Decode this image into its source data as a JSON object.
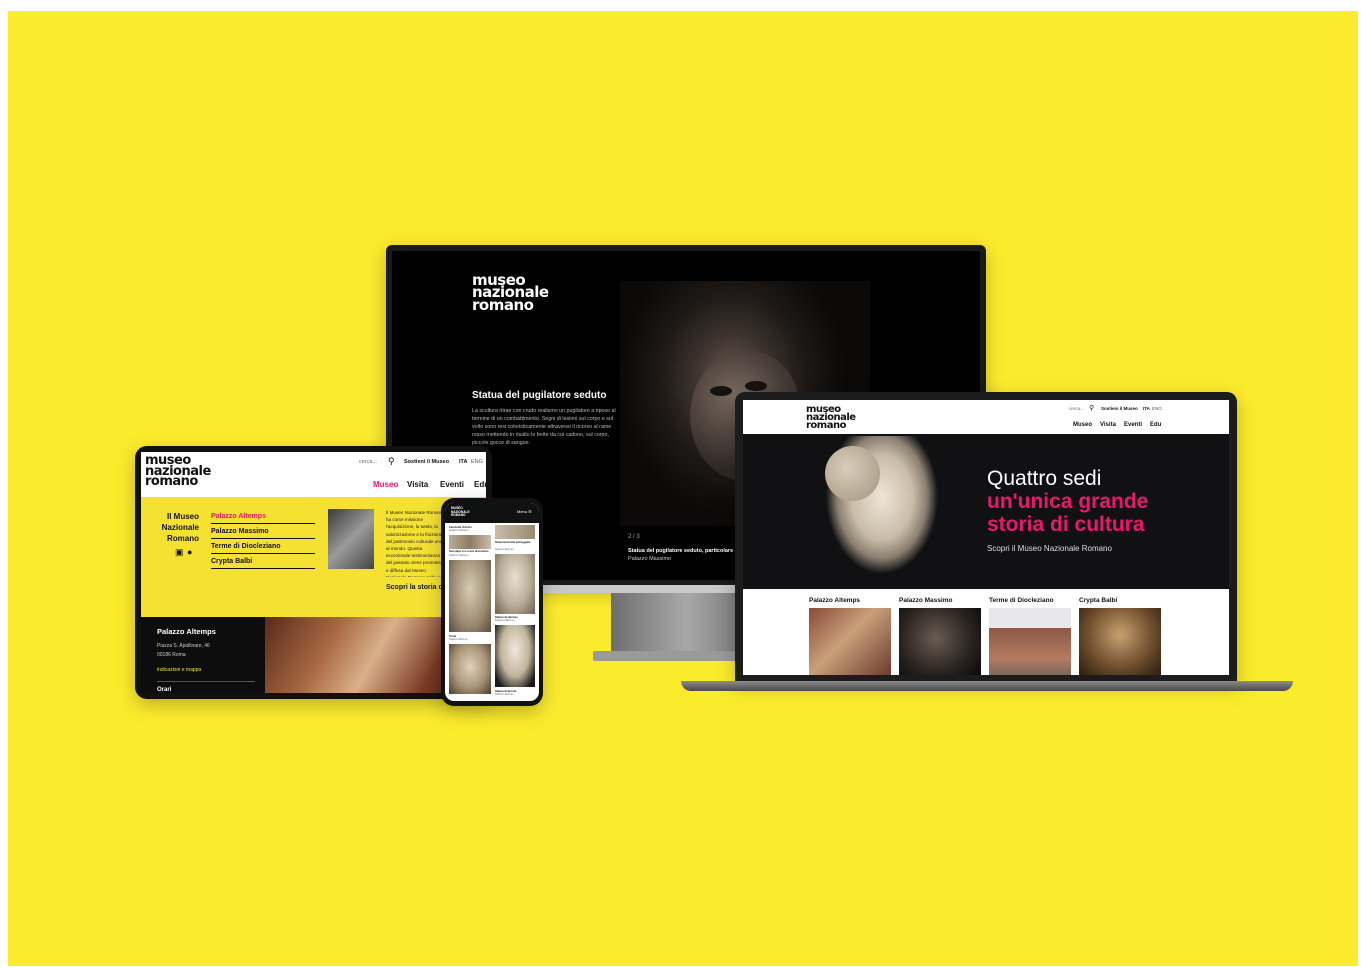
{
  "colors": {
    "background": "#fbeb2d",
    "accent_pink": "#e8196d",
    "museum_yellow": "#f5e132",
    "black": "#000000"
  },
  "desktop": {
    "logo": [
      "museo",
      "nazionale",
      "romano"
    ],
    "artwork_title": "Statua del pugilatore seduto",
    "artwork_text": "La scultura ritrae con crudo realismo un pugilatore a riposo al termine di un combattimento. Segni di lesioni sul corpo e sul volto sono resi coloristicamente attraverso il ricorso al rame rosso mettendo in risalto le ferite da cui cadono, sul corpo, piccole gocce di sangue.",
    "slide_counter": "2 / 3",
    "caption_title": "Statua del pugilatore seduto, particolare del",
    "caption_place": "Palazzo Massimo"
  },
  "laptop": {
    "logo": [
      "museo",
      "nazionale",
      "romano"
    ],
    "search_placeholder": "cerca...",
    "support_link": "Sostieni il Museo",
    "lang_ita": "ITA",
    "lang_eng": "ENG",
    "nav": [
      "Museo",
      "Visita",
      "Eventi",
      "Edu"
    ],
    "hero_line1": "Quattro sedi",
    "hero_line2": "un'unica grande",
    "hero_line3": "storia di cultura",
    "hero_sub": "Scopri il Museo Nazionale Romano",
    "venues": [
      "Palazzo Altemps",
      "Palazzo Massimo",
      "Terme di Diocleziano",
      "Crypta Balbi"
    ]
  },
  "tablet": {
    "logo": [
      "museo",
      "nazionale",
      "romano"
    ],
    "search_placeholder": "cerca...",
    "support_link": "Sostieni il Museo",
    "lang_ita": "ITA",
    "lang_eng": "ENG",
    "nav": [
      "Museo",
      "Visita",
      "Eventi",
      "Edu"
    ],
    "side_title": [
      "Il Museo",
      "Nazionale",
      "Romano"
    ],
    "venues": [
      "Palazzo Altemps",
      "Palazzo Massimo",
      "Terme di Diocleziano",
      "Crypta Balbi"
    ],
    "intro_text": "Il Museo Nazionale Romano ha come missione l'acquisizione, la tutela, la valorizzazione e la fruizione del patrimonio culturale unico al mondo. Questa eccezionale testimonianza del passato viene promossa e diffusa dal Museo Nazionale Romano nella sua futura il senso della continuità.",
    "discover_link": "Scopri la storia del",
    "info_title": "Palazzo Altemps",
    "address1": "Piazza S. Apollinare, 46",
    "address2": "00186 Roma",
    "map_link": "indicazioni e mappa",
    "hours_title": "Orari"
  },
  "phone": {
    "logo": [
      "MUSEO",
      "NAZIONALE",
      "ROMANO"
    ],
    "menu_label": "Menu ☰",
    "items": [
      {
        "title": "Fanciulla d'Anzio",
        "place": "Palazzo Massimo"
      },
      {
        "title": "Sarcofago con scene dionisiache",
        "place": "Palazzo Massimo"
      },
      {
        "title": "Statua femminile panneggiata",
        "place": "Palazzo Altemps"
      },
      {
        "title": "Statua di Hermes",
        "place": "Palazzo Massimo"
      },
      {
        "title": "Testa",
        "place": "Palazzo Altemps"
      },
      {
        "title": "Statua di Ercole",
        "place": "Palazzo Altemps"
      }
    ]
  }
}
